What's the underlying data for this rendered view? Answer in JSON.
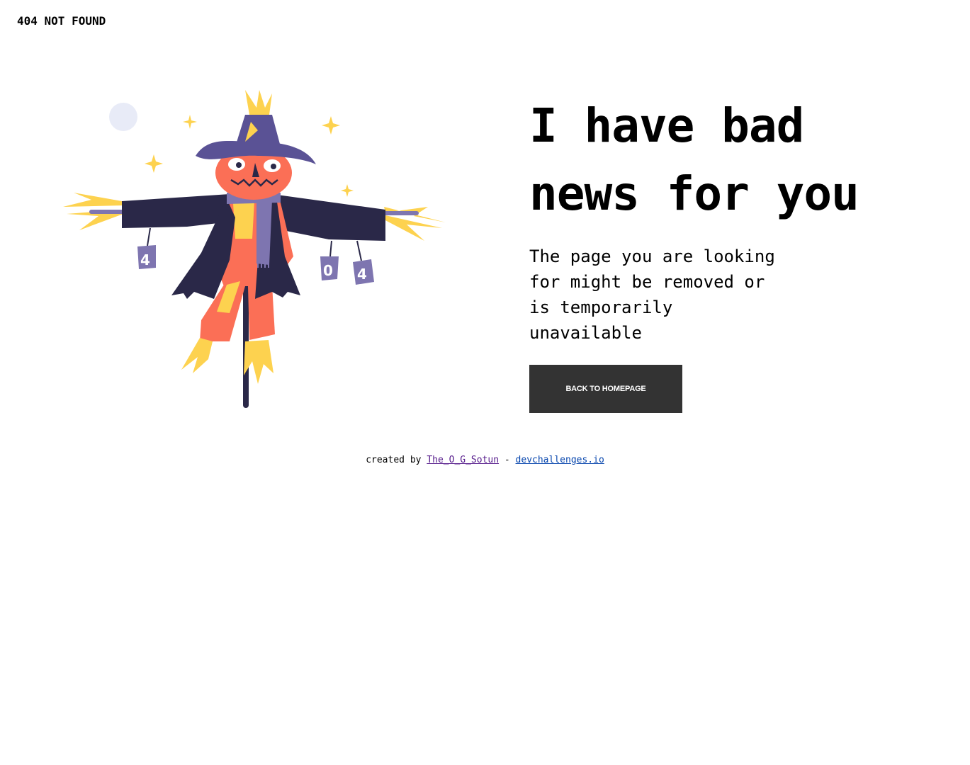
{
  "header": {
    "label": "404 NOT FOUND"
  },
  "illustration": {
    "can_left": "4",
    "can_middle": "0",
    "can_right": "4",
    "colors": {
      "hat": "#5a5295",
      "coat": "#2a2848",
      "face": "#fb6f56",
      "straw": "#fdd24f",
      "scarf": "#7e75b0",
      "moon": "#e8ebf7"
    }
  },
  "main": {
    "headline_line1": "I have bad",
    "headline_line2": "news for you",
    "subtext_line1": "The page you are looking",
    "subtext_line2": "for might be removed or",
    "subtext_line3": "is temporarily",
    "subtext_line4": "unavailable",
    "cta_label": "BACK TO HOMEPAGE"
  },
  "footer": {
    "prefix": "created by",
    "author": "The_O_G_Sotun",
    "separator": "-",
    "site": "devchallenges.io"
  }
}
